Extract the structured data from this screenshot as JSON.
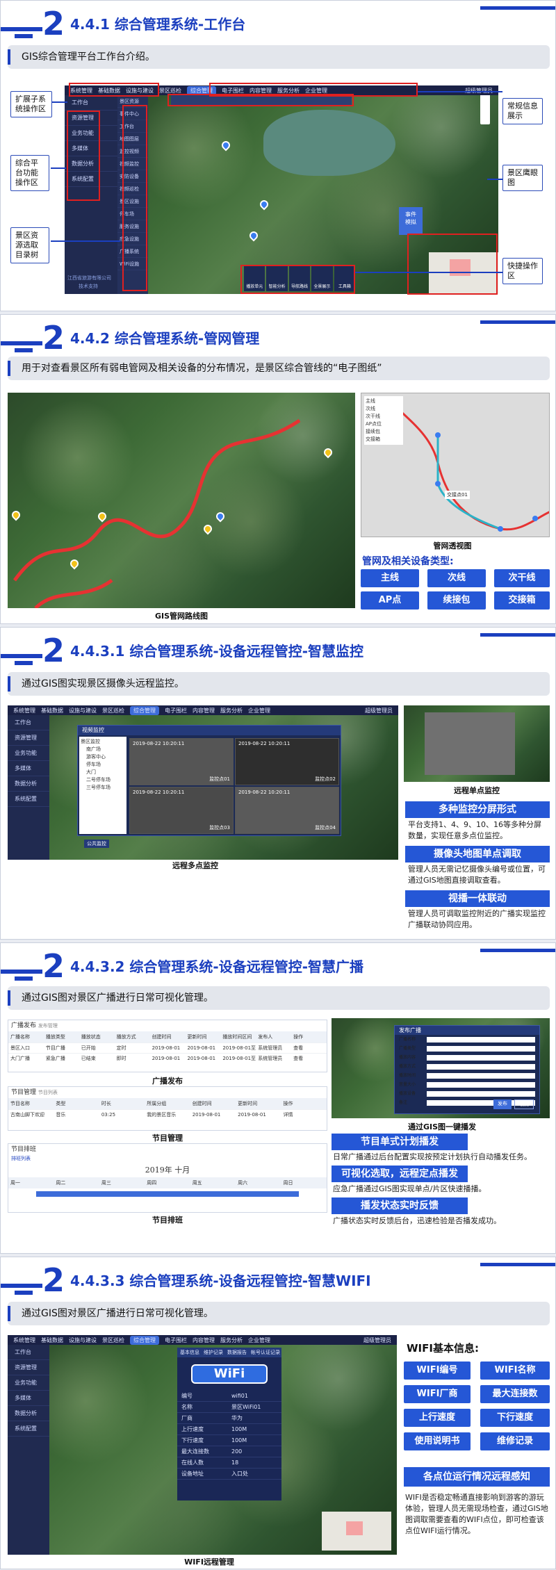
{
  "slides": [
    {
      "num": "2",
      "title": "4.4.1 综合管理系统-工作台",
      "intro": "GIS综合管理平台工作台介绍。",
      "menu": [
        "系统管理",
        "基础数据",
        "设施与建设",
        "景区巡检",
        "综合管理",
        "电子围栏",
        "内容管理",
        "服务分析",
        "企业管理"
      ],
      "menu_selected": "综合管理",
      "user": "超级管理员",
      "side": [
        "工作台",
        "资源管理",
        "业务功能",
        "多媒体",
        "数据分析",
        "系统配置"
      ],
      "side2": [
        "景区资源",
        "事件中心",
        "工作台",
        "地图图层",
        "监控视频",
        "视频监控",
        "安防设备",
        "视频巡检",
        "景区设施",
        "停车场",
        "服务设施",
        "应急设施",
        "广播系统",
        "WiFi设施"
      ],
      "footer": [
        "江西省旅游有限公司",
        "技术支持"
      ],
      "callouts": {
        "a": "扩展子系统操作区",
        "b": "综合平台功能操作区",
        "c": "景区资源选取目录树",
        "d": "常规信息展示",
        "e": "景区鹰眼图",
        "f": "快捷操作区"
      },
      "quick": [
        "播放单元",
        "智能分析",
        "导航路线",
        "全景展示",
        "工具箱"
      ],
      "map_label": "事件\n模拟"
    },
    {
      "num": "2",
      "title": "4.4.2 综合管理系统-管网管理",
      "intro": "用于对查看景区所有弱电管网及相关设备的分布情况，是景区综合管线的“电子图纸”",
      "legend": [
        "主线",
        "次线",
        "次干线",
        "AP点位",
        "接续包",
        "交接箱"
      ],
      "caption_left": "GIS管网路线图",
      "caption_right": "管网透视图",
      "types_title": "管网及相关设备类型:",
      "types": [
        "主线",
        "次线",
        "次干线",
        "AP点",
        "续接包",
        "交接箱"
      ],
      "node_label": "交接点01"
    },
    {
      "num": "2",
      "title": "4.4.3.1 综合管理系统-设备远程管控-智慧监控",
      "intro": "通过GIS图实现景区摄像头远程监控。",
      "dialog_title": "视频监控",
      "tabs": [
        "全局视频",
        "设备列表"
      ],
      "tree": [
        "景区监控",
        "南广场",
        "游客中心",
        "停车场",
        "大门",
        "二号停车场",
        "三号停车场"
      ],
      "videos": [
        {
          "ts": "2019-08-22 10:20:11",
          "lb": "监控点01"
        },
        {
          "ts": "2019-08-22 10:20:11",
          "lb": "监控点02"
        },
        {
          "ts": "2019-08-22 10:20:11",
          "lb": "监控点03"
        },
        {
          "ts": "2019-08-22 10:20:11",
          "lb": "监控点04"
        }
      ],
      "caption_left": "远程多点监控",
      "caption_right": "远程单点监控",
      "features": [
        {
          "head": "多种监控分屏形式",
          "desc": "平台支持1、4、9、10、16等多种分屏数量，实现任意多点位监控。"
        },
        {
          "head": "摄像头地图单点调取",
          "desc": "管理人员无需记忆摄像头编号或位置，可通过GIS地图直接调取查看。"
        },
        {
          "head": "视播一体联动",
          "desc": "管理人员可调取监控附近的广播实现监控广播联动协同应用。"
        }
      ],
      "bottom_label": "公共监控"
    },
    {
      "num": "2",
      "title": "4.4.3.2 综合管理系统-设备远程管控-智慧广播",
      "intro": "通过GIS图对景区广播进行日常可视化管理。",
      "panel1": {
        "title": "广播发布",
        "sub": "发布管理",
        "cols": [
          "广播名称",
          "播放类型",
          "播放状态",
          "播放方式",
          "创建时间",
          "更新时间",
          "播放时间区间",
          "发布人",
          "操作"
        ],
        "rows": [
          [
            "景区入口",
            "节目广播",
            "已开始",
            "定时",
            "2019-08-01",
            "2019-08-01",
            "2019-08-01至2019-08-31",
            "系统管理员",
            "查看"
          ],
          [
            "大门广播",
            "紧急广播",
            "已结束",
            "即时",
            "2019-08-01",
            "2019-08-01",
            "2019-08-01至2019-08-31",
            "系统管理员",
            "查看"
          ]
        ]
      },
      "caption1": "广播发布",
      "panel2": {
        "title": "节目管理",
        "sub": "节目列表",
        "cols": [
          "节目名称",
          "类型",
          "时长",
          "所属分组",
          "创建时间",
          "更新时间",
          "操作"
        ],
        "rows": [
          [
            "古南山脚下欢迎",
            "音乐",
            "03:25",
            "我的景区音乐",
            "2019-08-01",
            "2019-08-01",
            "详情"
          ]
        ]
      },
      "caption2": "节目管理",
      "panel3": {
        "title": "节目排班",
        "tabs": [
          "排班列表"
        ],
        "month": "2019年 十月",
        "days": [
          "周一",
          "周二",
          "周三",
          "周四",
          "周五",
          "周六",
          "周日"
        ]
      },
      "caption3": "节目排班",
      "dialog": {
        "title": "发布广播",
        "fields": [
          "广播名称",
          "广播类型",
          "播放内容",
          "播放方式",
          "播放时间",
          "音量大小",
          "播放设备",
          "备注"
        ],
        "ok": "发布",
        "cancel": "取消"
      },
      "caption4": "通过GIS图一键播发",
      "features": [
        {
          "head": "节目单式计划播发",
          "desc": "日常广播通过后台配置实现按预定计划执行自动播发任务。"
        },
        {
          "head": "可视化选取，远程定点播发",
          "desc": "应急广播通过GIS图实现单点/片区快速播播。"
        },
        {
          "head": "播发状态实时反馈",
          "desc": "广播状态实时反馈后台，迅速检验是否播发成功。"
        }
      ]
    },
    {
      "num": "2",
      "title": "4.4.3.3 综合管理系统-设备远程管控-智慧WIFI",
      "intro": "通过GIS图对景区广播进行日常可视化管理。",
      "wifi_tabs": [
        "基本信息",
        "维护记录",
        "数据报告",
        "帐号认证记录"
      ],
      "wifi_logo": "WiFi",
      "wifi_kv": [
        [
          "编号",
          "wifi01"
        ],
        [
          "名称",
          "景区WiFi01"
        ],
        [
          "厂商",
          "华为"
        ],
        [
          "上行速度",
          "100M"
        ],
        [
          "下行速度",
          "100M"
        ],
        [
          "最大连接数",
          "200"
        ],
        [
          "在线人数",
          "18"
        ],
        [
          "设备地址",
          "入口处"
        ]
      ],
      "caption": "WIFI远程管理",
      "info_title": "WIFI基本信息:",
      "info": [
        "WIFI编号",
        "WIFI名称",
        "WIFI厂商",
        "最大连接数",
        "上行速度",
        "下行速度",
        "使用说明书",
        "维修记录"
      ],
      "feature_head": "各点位运行情况远程感知",
      "feature_desc": "WIFI是否稳定畅通直接影响到游客的游玩体验，管理人员无需现场检查，通过GIS地图调取需要查看的WIFI点位，即可检查该点位WIFI运行情况。"
    }
  ],
  "colors": {
    "brand": "#1b3fbf",
    "button": "#2557d6",
    "red": "#e02020"
  }
}
